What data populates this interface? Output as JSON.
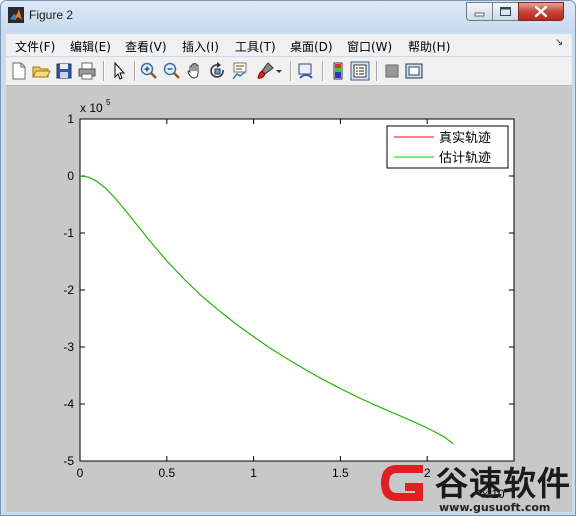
{
  "window": {
    "title": "Figure 2"
  },
  "menu": {
    "items": [
      "文件(F)",
      "编辑(E)",
      "查看(V)",
      "插入(I)",
      "工具(T)",
      "桌面(D)",
      "窗口(W)",
      "帮助(H)"
    ]
  },
  "toolbar": {
    "icons": [
      "new-figure-icon",
      "open-file-icon",
      "save-icon",
      "print-icon",
      "select-arrow-icon",
      "zoom-in-icon",
      "zoom-out-icon",
      "pan-hand-icon",
      "rotate-3d-icon",
      "data-cursor-icon",
      "brush-icon",
      "brush-dropdown-icon",
      "link-plot-icon",
      "insert-colorbar-icon",
      "insert-legend-icon",
      "hide-plot-tools-icon",
      "show-plot-tools-icon"
    ]
  },
  "chart_data": {
    "type": "line",
    "title": "",
    "xlabel": "",
    "ylabel": "",
    "x_exponent": "x 10",
    "y_exponent": "x 10",
    "y_exponent_power": "5",
    "xlim": [
      0,
      2.5
    ],
    "ylim": [
      -5,
      1
    ],
    "xticks": [
      "0",
      "0.5",
      "1",
      "1.5",
      "2"
    ],
    "yticks": [
      "1",
      "0",
      "-1",
      "-2",
      "-3",
      "-4",
      "-5"
    ],
    "xtick_values": [
      0,
      0.5,
      1,
      1.5,
      2
    ],
    "ytick_values": [
      1,
      0,
      -1,
      -2,
      -3,
      -4,
      -5
    ],
    "legend_position": "top-right",
    "grid": false,
    "series": [
      {
        "name": "真实轨迹",
        "color": "#ff0000",
        "x": [
          0,
          0.05,
          0.1,
          0.15,
          0.2,
          0.25,
          0.3,
          0.35,
          0.4,
          0.45,
          0.5,
          0.6,
          0.7,
          0.8,
          0.9,
          1.0,
          1.1,
          1.2,
          1.3,
          1.4,
          1.5,
          1.6,
          1.7,
          1.8,
          1.9,
          2.0,
          2.1,
          2.15
        ],
        "y": [
          0,
          -0.02,
          -0.1,
          -0.22,
          -0.38,
          -0.56,
          -0.75,
          -0.94,
          -1.13,
          -1.31,
          -1.49,
          -1.81,
          -2.1,
          -2.36,
          -2.6,
          -2.82,
          -3.03,
          -3.22,
          -3.4,
          -3.57,
          -3.73,
          -3.88,
          -4.02,
          -4.15,
          -4.28,
          -4.42,
          -4.58,
          -4.7
        ]
      },
      {
        "name": "估计轨迹",
        "color": "#00cc00",
        "x": [
          0,
          0.05,
          0.1,
          0.15,
          0.2,
          0.25,
          0.3,
          0.35,
          0.4,
          0.45,
          0.5,
          0.6,
          0.7,
          0.8,
          0.9,
          1.0,
          1.1,
          1.2,
          1.3,
          1.4,
          1.5,
          1.6,
          1.7,
          1.8,
          1.9,
          2.0,
          2.1,
          2.15
        ],
        "y": [
          0,
          -0.02,
          -0.1,
          -0.22,
          -0.38,
          -0.56,
          -0.75,
          -0.94,
          -1.13,
          -1.31,
          -1.49,
          -1.81,
          -2.1,
          -2.36,
          -2.6,
          -2.82,
          -3.03,
          -3.22,
          -3.4,
          -3.57,
          -3.73,
          -3.88,
          -4.02,
          -4.15,
          -4.28,
          -4.42,
          -4.58,
          -4.7
        ]
      }
    ]
  },
  "watermark": {
    "text": "谷速软件",
    "url": "www.gusuoft.com"
  }
}
